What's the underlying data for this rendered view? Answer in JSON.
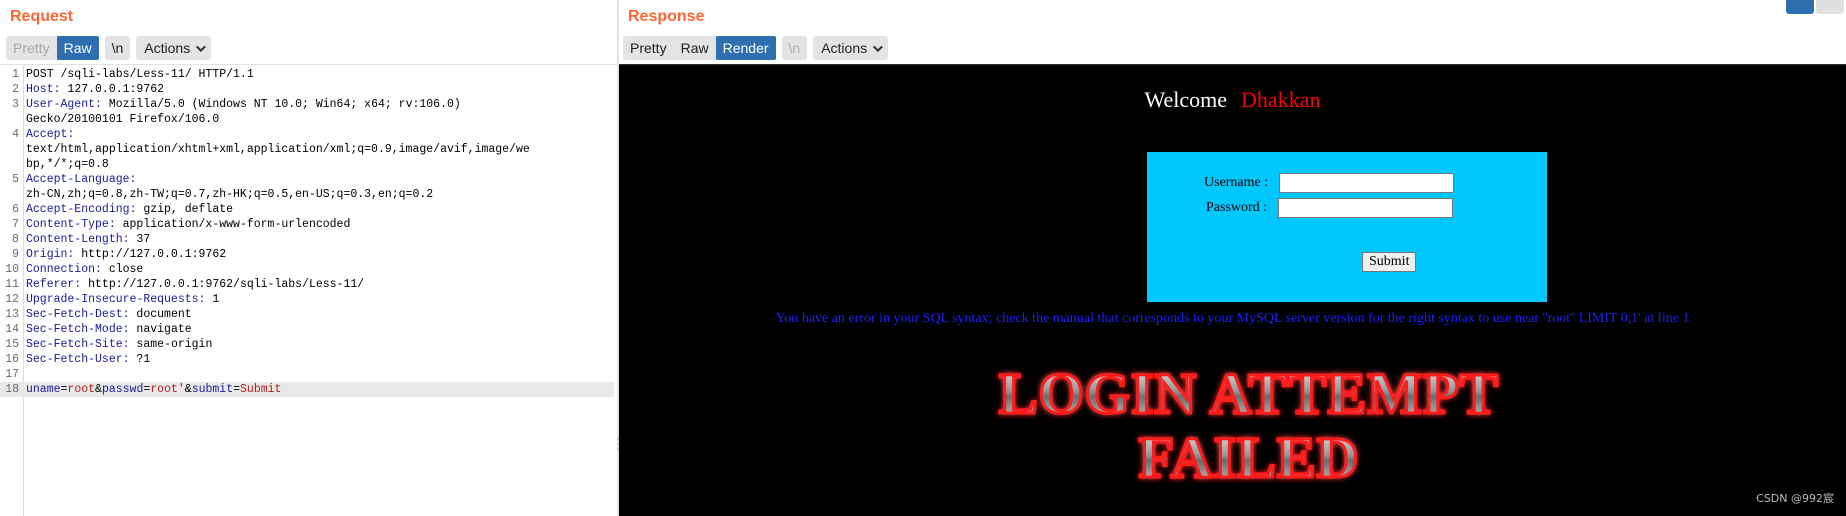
{
  "request": {
    "title": "Request",
    "tabs": [
      {
        "label": "Pretty",
        "state": "disabled"
      },
      {
        "label": "Raw",
        "state": "active"
      }
    ],
    "newline_label": "\\n",
    "actions_label": "Actions",
    "lines": [
      {
        "n": "1",
        "key": "",
        "value": "POST /sqli-labs/Less-11/ HTTP/1.1"
      },
      {
        "n": "2",
        "key": "Host:",
        "value": " 127.0.0.1:9762"
      },
      {
        "n": "3",
        "key": "User-Agent:",
        "value": " Mozilla/5.0 (Windows NT 10.0; Win64; x64; rv:106.0)"
      },
      {
        "n": "",
        "key": "",
        "value": "Gecko/20100101 Firefox/106.0"
      },
      {
        "n": "4",
        "key": "Accept:",
        "value": ""
      },
      {
        "n": "",
        "key": "",
        "value": "text/html,application/xhtml+xml,application/xml;q=0.9,image/avif,image/we"
      },
      {
        "n": "",
        "key": "",
        "value": "bp,*/*;q=0.8"
      },
      {
        "n": "5",
        "key": "Accept-Language:",
        "value": ""
      },
      {
        "n": "",
        "key": "",
        "value": "zh-CN,zh;q=0.8,zh-TW;q=0.7,zh-HK;q=0.5,en-US;q=0.3,en;q=0.2"
      },
      {
        "n": "6",
        "key": "Accept-Encoding:",
        "value": " gzip, deflate"
      },
      {
        "n": "7",
        "key": "Content-Type:",
        "value": " application/x-www-form-urlencoded"
      },
      {
        "n": "8",
        "key": "Content-Length:",
        "value": " 37"
      },
      {
        "n": "9",
        "key": "Origin:",
        "value": " http://127.0.0.1:9762"
      },
      {
        "n": "10",
        "key": "Connection:",
        "value": " close"
      },
      {
        "n": "11",
        "key": "Referer:",
        "value": " http://127.0.0.1:9762/sqli-labs/Less-11/"
      },
      {
        "n": "12",
        "key": "Upgrade-Insecure-Requests:",
        "value": " 1"
      },
      {
        "n": "13",
        "key": "Sec-Fetch-Dest:",
        "value": " document"
      },
      {
        "n": "14",
        "key": "Sec-Fetch-Mode:",
        "value": " navigate"
      },
      {
        "n": "15",
        "key": "Sec-Fetch-Site:",
        "value": " same-origin"
      },
      {
        "n": "16",
        "key": "Sec-Fetch-User:",
        "value": " ?1"
      },
      {
        "n": "17",
        "key": "",
        "value": ""
      }
    ],
    "body_line": {
      "n": "18",
      "params": [
        {
          "name": "uname",
          "value": "root"
        },
        {
          "name": "passwd",
          "value": "root'"
        },
        {
          "name": "submit",
          "value": "Submit"
        }
      ]
    }
  },
  "response": {
    "title": "Response",
    "tabs": [
      {
        "label": "Pretty",
        "state": "normal"
      },
      {
        "label": "Raw",
        "state": "normal"
      },
      {
        "label": "Render",
        "state": "active"
      }
    ],
    "newline_label": "\\n",
    "actions_label": "Actions",
    "page": {
      "welcome": "Welcome",
      "user": "Dhakkan",
      "username_label": "Username :",
      "password_label": "Password :",
      "submit_label": "Submit",
      "error": "You have an error in your SQL syntax; check the manual that corresponds to your MySQL server version for the right syntax to use near ''root'' LIMIT 0,1' at line 1",
      "failed_line1": "LOGIN ATTEMPT",
      "failed_line2": "FAILED"
    }
  },
  "watermark": "CSDN @992宸",
  "colors": {
    "title": "#ff6633",
    "active_tab": "#2f6fb0",
    "login_box": "#00c8ff",
    "error_text": "#1f1fff",
    "user_name": "#ff0000"
  }
}
